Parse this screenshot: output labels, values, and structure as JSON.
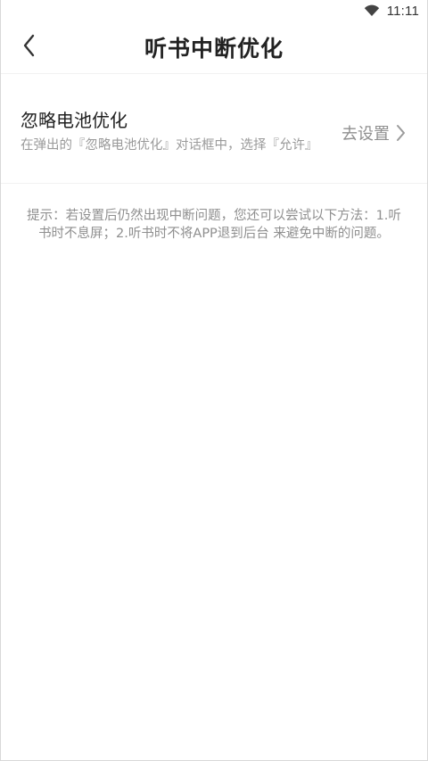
{
  "status_bar": {
    "time": "11:11",
    "icon": "wifi-icon"
  },
  "header": {
    "title": "听书中断优化",
    "back_icon": "chevron-left-icon"
  },
  "setting_item": {
    "title": "忽略电池优化",
    "description": "在弹出的『忽略电池优化』对话框中，选择『允许』",
    "action_label": "去设置",
    "action_icon": "chevron-right-icon"
  },
  "tips": {
    "text": "提示：若设置后仍然出现中断问题，您还可以尝试以下方法：1.听书时不息屏；2.听书时不将APP退到后台 来避免中断的问题。"
  }
}
